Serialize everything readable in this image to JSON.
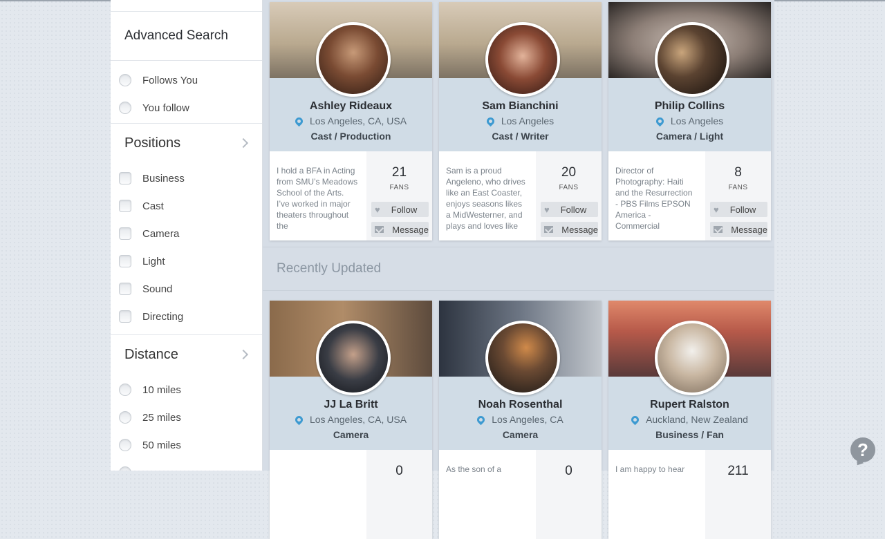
{
  "sidebar": {
    "title": "Advanced Search",
    "follow_options": [
      "Follows You",
      "You follow"
    ],
    "positions_title": "Positions",
    "positions": [
      "Business",
      "Cast",
      "Camera",
      "Light",
      "Sound",
      "Directing"
    ],
    "distance_title": "Distance",
    "distances": [
      "10 miles",
      "25 miles",
      "50 miles"
    ]
  },
  "top_cards": [
    {
      "name": "Ashley Rideaux",
      "location": "Los Angeles, CA, USA",
      "role": "Cast / Production",
      "bio": "I hold a BFA in Acting from SMU’s Meadows School of the Arts. I’ve worked in major theaters throughout the",
      "fans_count": "21",
      "fans_label": "FANS",
      "follow": "Follow",
      "message": "Message"
    },
    {
      "name": "Sam Bianchini",
      "location": "Los Angeles",
      "role": "Cast / Writer",
      "bio": "Sam is a proud Angeleno, who drives like an East Coaster, enjoys seasons likes a MidWesterner, and plays and loves like",
      "fans_count": "20",
      "fans_label": "FANS",
      "follow": "Follow",
      "message": "Message"
    },
    {
      "name": "Philip Collins",
      "location": "Los Angeles",
      "role": "Camera / Light",
      "bio": "Director of Photography: Haiti and the Resurrection - PBS Films EPSON America - Commercial",
      "fans_count": "8",
      "fans_label": "FANS",
      "follow": "Follow",
      "message": "Message"
    }
  ],
  "recently_updated": "Recently Updated",
  "bottom_cards": [
    {
      "name": "JJ La Britt",
      "location": "Los Angeles, CA, USA",
      "role": "Camera",
      "bio": "",
      "fans_count": "0"
    },
    {
      "name": "Noah Rosenthal",
      "location": "Los Angeles, CA",
      "role": "Camera",
      "bio": "As the son of a",
      "fans_count": "0"
    },
    {
      "name": "Rupert Ralston",
      "location": "Auckland, New Zealand",
      "role": "Business / Fan",
      "bio": "I am happy to hear",
      "fans_count": "211"
    }
  ],
  "help_label": "?"
}
